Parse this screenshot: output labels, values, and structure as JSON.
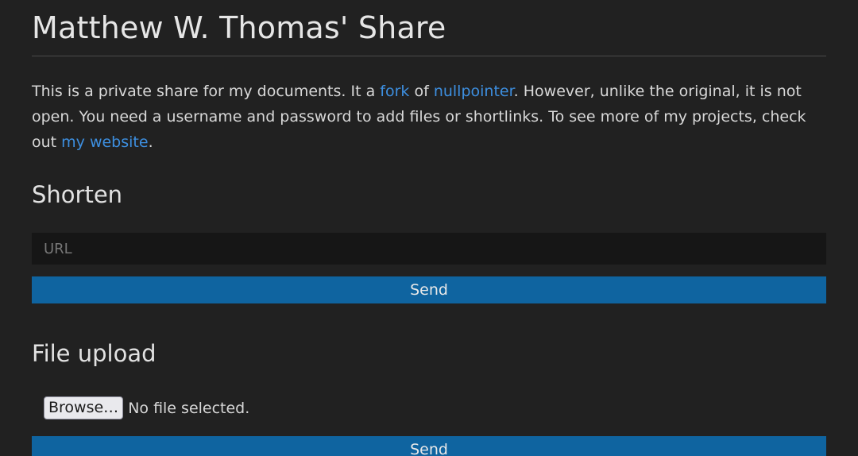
{
  "page": {
    "title": "Matthew W. Thomas' Share"
  },
  "intro": {
    "part1": "This is a private share for my documents. It a ",
    "link_fork": "fork",
    "part2": " of ",
    "link_nullpointer": "nullpointer",
    "part3": ". However, unlike the original, it is not open. You need a username and password to add files or shortlinks. To see more of my projects, check out ",
    "link_website": "my website",
    "part4": "."
  },
  "shorten": {
    "title": "Shorten",
    "url_placeholder": "URL",
    "url_value": "",
    "send_label": "Send"
  },
  "upload": {
    "title": "File upload",
    "browse_label": "Browse…",
    "file_status": "No file selected.",
    "send_label": "Send"
  },
  "colors": {
    "background": "#212121",
    "link": "#3d8fe0",
    "button": "#0f64a0",
    "input_background": "#161616"
  }
}
